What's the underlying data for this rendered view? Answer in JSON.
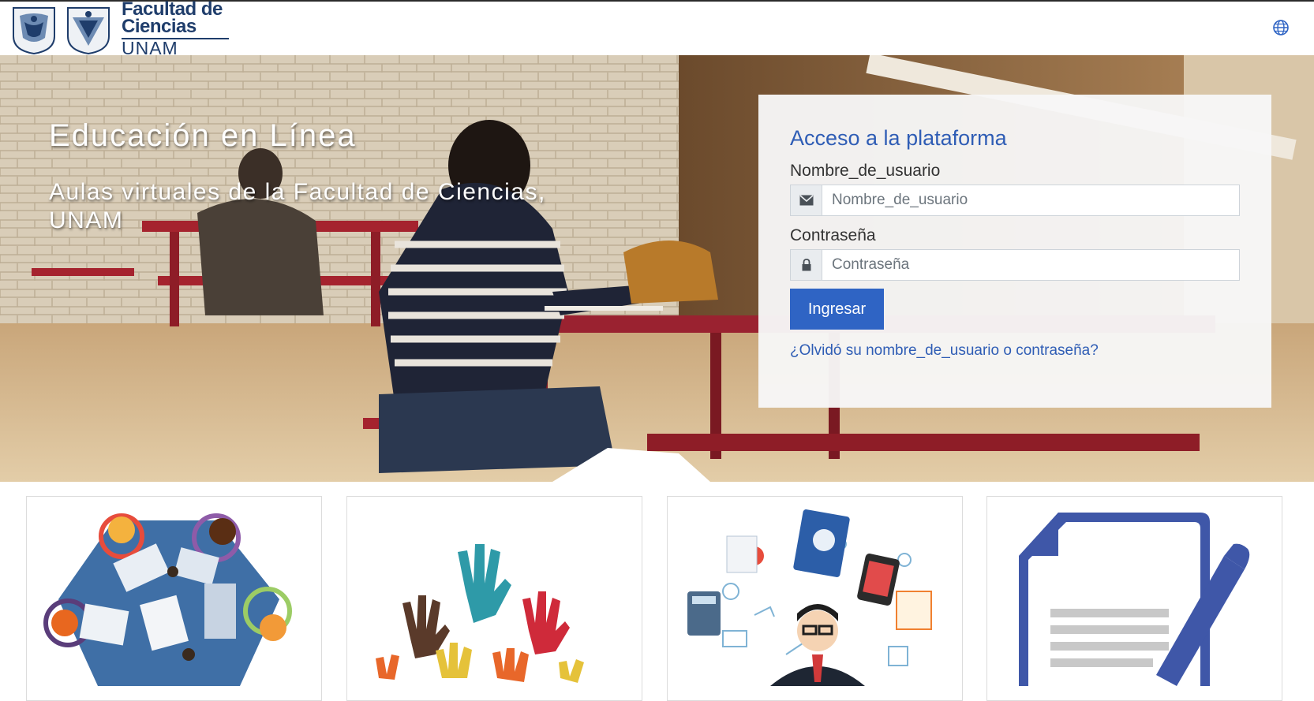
{
  "header": {
    "brand_line1": "Facultad de",
    "brand_line2": "Ciencias",
    "brand_line3": "UNAM",
    "language_icon": "globe-icon"
  },
  "hero": {
    "title": "Educación en Línea",
    "subtitle": "Aulas virtuales de la Facultad de Ciencias, UNAM"
  },
  "login": {
    "heading": "Acceso a la plataforma",
    "username_label": "Nombre_de_usuario",
    "username_placeholder": "Nombre_de_usuario",
    "username_icon": "envelope-icon",
    "password_label": "Contraseña",
    "password_placeholder": "Contraseña",
    "password_icon": "lock-icon",
    "submit_label": "Ingresar",
    "forgot_link": "¿Olvidó su nombre_de_usuario o contraseña?"
  },
  "cards": [
    {
      "image": "collaboration-table-illustration"
    },
    {
      "image": "raised-hands-illustration"
    },
    {
      "image": "teacher-tools-illustration"
    },
    {
      "image": "document-pen-illustration"
    }
  ],
  "colors": {
    "accent": "#2f64c4",
    "link": "#2f5db5",
    "brand": "#1f3d6b"
  }
}
